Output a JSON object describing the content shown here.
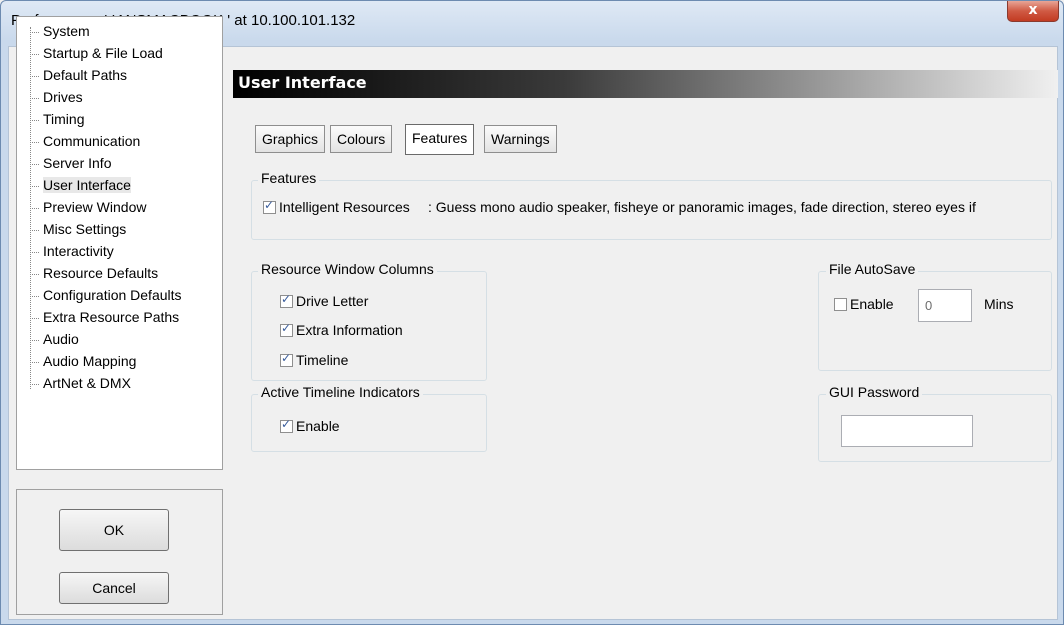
{
  "window": {
    "title": "Preferences  :  ' IANSMACBOOK '  at  10.100.101.132",
    "close_glyph": "x"
  },
  "tree": {
    "items": [
      "System",
      "Startup & File Load",
      "Default Paths",
      "Drives",
      "Timing",
      "Communication",
      "Server Info",
      "User Interface",
      "Preview Window",
      "Misc Settings",
      "Interactivity",
      "Resource Defaults",
      "Configuration Defaults",
      "Extra Resource Paths",
      "Audio",
      "Audio Mapping",
      "ArtNet & DMX"
    ],
    "selected": "User Interface"
  },
  "buttons": {
    "ok": "OK",
    "cancel": "Cancel"
  },
  "section": {
    "title": "User Interface"
  },
  "tabs": [
    "Graphics",
    "Colours",
    "Features",
    "Warnings"
  ],
  "active_tab": "Features",
  "features": {
    "group_title": "Features",
    "intelligent_label": "Intelligent Resources",
    "intelligent_checked": true,
    "intelligent_desc": ": Guess mono audio speaker, fisheye or panoramic images, fade direction, stereo eyes if"
  },
  "resource_columns": {
    "group_title": "Resource Window Columns",
    "items": [
      {
        "label": "Drive Letter",
        "checked": true
      },
      {
        "label": "Extra Information",
        "checked": true
      },
      {
        "label": "Timeline",
        "checked": true
      }
    ]
  },
  "timeline_indicators": {
    "group_title": "Active Timeline Indicators",
    "enable_label": "Enable",
    "enable_checked": true
  },
  "autosave": {
    "group_title": "File AutoSave",
    "enable_label": "Enable",
    "enable_checked": false,
    "minutes_value": "0",
    "minutes_unit": "Mins"
  },
  "gui_password": {
    "group_title": "GUI Password",
    "value": ""
  },
  "colors": {
    "header_bg": "#000000",
    "check_color": "#3a5d9c",
    "close_button": "#c23b22"
  }
}
